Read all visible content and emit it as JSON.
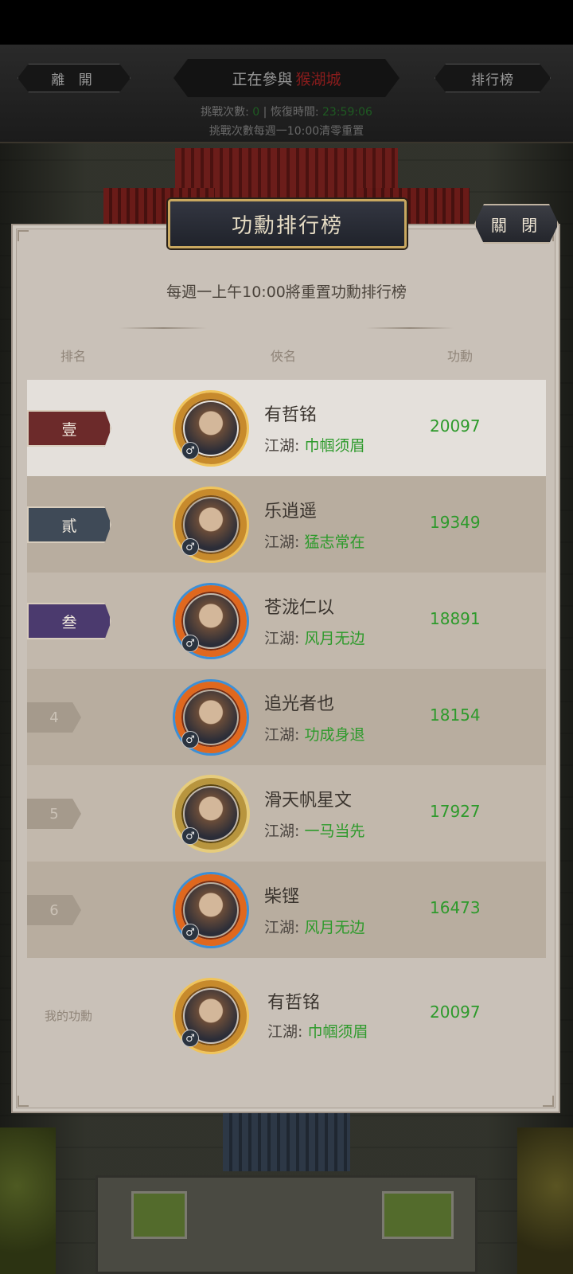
{
  "hud": {
    "leave_label": "離 開",
    "participating_label": "正在參與",
    "city_name": "猴湖城",
    "rank_label": "排行榜",
    "challenge_count_label": "挑戰次數:",
    "challenge_count_value": "0",
    "recover_time_label": "恢復時間:",
    "recover_time_value": "23:59:06",
    "reset_note": "挑戰次數每週一10:00清零重置"
  },
  "panel": {
    "title": "功勳排行榜",
    "close_label": "關 閉",
    "subtitle": "每週一上午10:00將重置功勳排行榜",
    "columns": {
      "rank": "排名",
      "name": "俠名",
      "merit": "功勳"
    }
  },
  "rows": [
    {
      "rank": "壹",
      "name": "有哲铭",
      "title_label": "江湖:",
      "title": "巾帼须眉",
      "merit": "20097"
    },
    {
      "rank": "貳",
      "name": "乐逍遥",
      "title_label": "江湖:",
      "title": "猛志常在",
      "merit": "19349"
    },
    {
      "rank": "叁",
      "name": "苍泷仁以",
      "title_label": "江湖:",
      "title": "风月无边",
      "merit": "18891"
    },
    {
      "rank": "4",
      "name": "追光者也",
      "title_label": "江湖:",
      "title": "功成身退",
      "merit": "18154"
    },
    {
      "rank": "5",
      "name": "滑天帆星文",
      "title_label": "江湖:",
      "title": "一马当先",
      "merit": "17927"
    },
    {
      "rank": "6",
      "name": "柴铿",
      "title_label": "江湖:",
      "title": "风月无边",
      "merit": "16473"
    }
  ],
  "me": {
    "label": "我的功勳",
    "name": "有哲铭",
    "title_label": "江湖:",
    "title": "巾帼须眉",
    "merit": "20097"
  },
  "gender_symbol": "♂",
  "colors": {
    "merit_green": "#2d9a2b",
    "rank1": "#6c2a2a",
    "rank2": "#3f4a57",
    "rank3": "#4b3a6e"
  }
}
